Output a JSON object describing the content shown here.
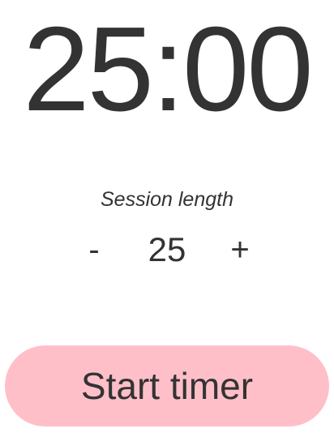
{
  "timer": {
    "display": "25:00"
  },
  "session": {
    "label": "Session length",
    "decrement_label": "-",
    "value": "25",
    "increment_label": "+"
  },
  "actions": {
    "start_label": "Start timer"
  },
  "colors": {
    "text": "#333333",
    "start_button_bg": "#ffbfc9",
    "background": "#ffffff"
  }
}
